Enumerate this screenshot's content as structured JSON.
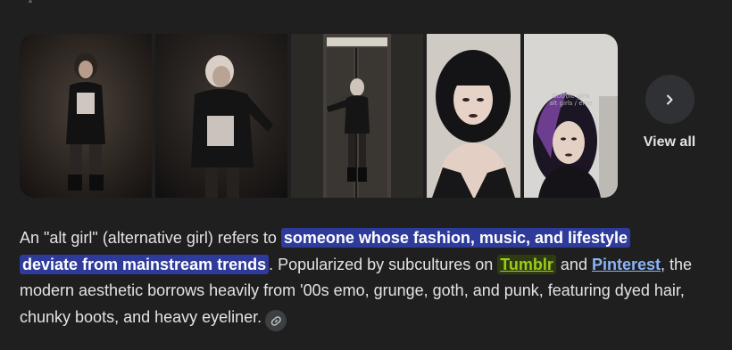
{
  "images": {
    "items": [
      {
        "name": "alt-girl-photo-1",
        "caption": ""
      },
      {
        "name": "alt-girl-photo-2",
        "caption": ""
      },
      {
        "name": "alt-girl-photo-3",
        "caption": ""
      },
      {
        "name": "alt-girl-photo-4",
        "caption": ""
      },
      {
        "name": "alt-girl-photo-5",
        "caption": "Goth/ic girls\nalt girls / emo"
      }
    ],
    "view_all_label": "View all",
    "view_all_icon": "chevron-right-icon"
  },
  "answer": {
    "intro": "An \"alt girl\" (alternative girl) refers to ",
    "highlight_1": "someone whose fashion, music, and lifestyle",
    "highlight_2": "deviate from mainstream trends",
    "middle": ". Popularized by subcultures on ",
    "link_tumblr": "Tumblr",
    "and_text": " and ",
    "link_pinterest": "Pinterest",
    "rest": ", the modern aesthetic borrows heavily from '00s emo, grunge, goth, and punk, featuring dyed hair, chunky boots, and heavy eyeliner.",
    "link_chip_icon": "link-icon"
  },
  "colors": {
    "background": "#1f1f1f",
    "highlight": "#2f3b9a",
    "tumblr_highlight": "#2e3b10",
    "tumblr_text": "#9ccc1c",
    "link": "#8ab4f8"
  }
}
